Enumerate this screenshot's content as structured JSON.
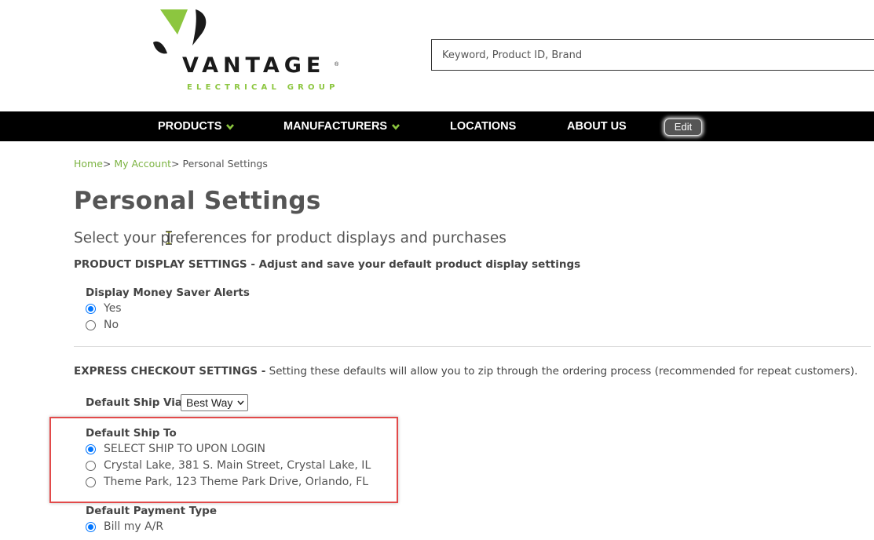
{
  "header": {
    "logo_word": "VANTAGE",
    "logo_reg": "®",
    "logo_sub": "ELECTRICAL GROUP",
    "search_placeholder": "Keyword, Product ID, Brand"
  },
  "nav": {
    "items": [
      {
        "label": "PRODUCTS"
      },
      {
        "label": "MANUFACTURERS"
      },
      {
        "label": "LOCATIONS"
      },
      {
        "label": "ABOUT US"
      }
    ],
    "edit_label": "Edit"
  },
  "breadcrumb": {
    "home": "Home",
    "sep1": ">",
    "account": "My Account",
    "sep2": ">",
    "current": "Personal Settings"
  },
  "page": {
    "title": "Personal Settings",
    "subtitle": "Select your preferences for product displays and purchases"
  },
  "product_display": {
    "heading": "PRODUCT DISPLAY SETTINGS - Adjust and save your default product display settings",
    "money_saver": {
      "label": "Display Money Saver Alerts",
      "options": [
        {
          "label": "Yes",
          "selected": true
        },
        {
          "label": "No",
          "selected": false
        }
      ]
    }
  },
  "express_checkout": {
    "heading_bold": "EXPRESS CHECKOUT SETTINGS -",
    "heading_text": " Setting these defaults will allow you to zip through the ordering process (recommended for repeat customers).",
    "ship_via": {
      "label": "Default Ship Via",
      "selected": "Best Way"
    },
    "ship_to": {
      "label": "Default Ship To",
      "options": [
        {
          "label": "SELECT SHIP TO UPON LOGIN",
          "selected": true
        },
        {
          "label": "Crystal Lake, 381 S. Main Street, Crystal Lake, IL",
          "selected": false
        },
        {
          "label": "Theme Park, 123 Theme Park Drive, Orlando, FL",
          "selected": false
        }
      ]
    },
    "payment": {
      "label": "Default Payment Type",
      "options": [
        {
          "label": "Bill my A/R",
          "selected": true
        }
      ]
    }
  },
  "colors": {
    "accent_green": "#8cc63f",
    "link_green": "#7cb342",
    "nav_bg": "#000000",
    "radio_blue": "#0075ff",
    "highlight_red": "#e24a4a"
  }
}
